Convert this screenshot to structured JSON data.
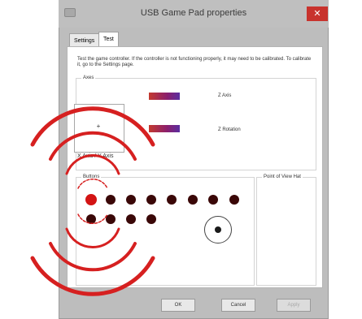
{
  "window": {
    "title": "USB Game Pad properties",
    "close_glyph": "✕"
  },
  "tabs": [
    {
      "label": "Settings"
    },
    {
      "label": "Test"
    }
  ],
  "test": {
    "instructions": "Test the game controller. If the controller is not functioning properly, it may need to be calibrated. To calibrate it, go to the Settings page.",
    "axes_label": "Axes",
    "xy_label": "X Axis / Y Axis",
    "crosshair": "+",
    "z_axis_label": "Z Axis",
    "z_rotation_label": "Z Rotation",
    "buttons_label": "Buttons",
    "pov_label": "Point of View Hat",
    "buttons_pressed": [
      1
    ]
  },
  "footer": {
    "ok": "OK",
    "cancel": "Cancel",
    "apply": "Apply"
  },
  "colors": {
    "pressed_button": "#d31414",
    "idle_button": "#3a0707",
    "ripple": "#d62020"
  }
}
